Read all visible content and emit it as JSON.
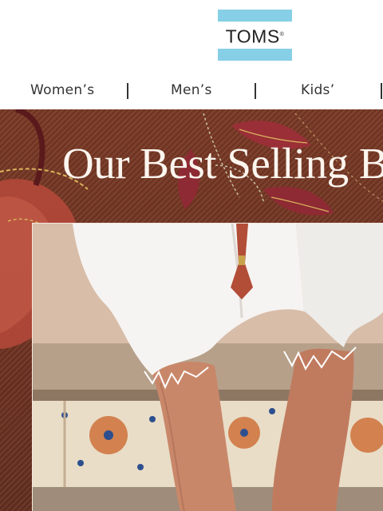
{
  "brand": {
    "logo_text": "TOMS",
    "logo_mark": "®",
    "band_color": "#86cfe6"
  },
  "nav": {
    "items": [
      {
        "label": "Women’s"
      },
      {
        "label": "Men’s"
      },
      {
        "label": "Kids’"
      }
    ]
  },
  "hero": {
    "title": "Our Best Selling Ba",
    "background_color": "#6f3322",
    "accent_color": "#a8322e",
    "photo_description_icon": "product-lifestyle-photo"
  }
}
